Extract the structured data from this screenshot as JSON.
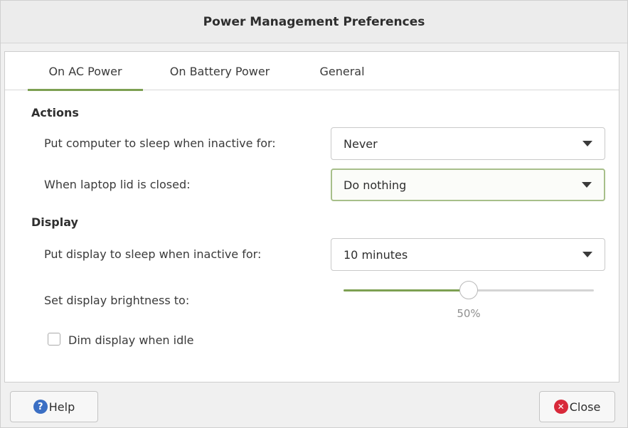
{
  "window": {
    "title": "Power Management Preferences"
  },
  "tabs": [
    {
      "label": "On AC Power",
      "active": true
    },
    {
      "label": "On Battery Power",
      "active": false
    },
    {
      "label": "General",
      "active": false
    }
  ],
  "actions": {
    "heading": "Actions",
    "sleep_label": "Put computer to sleep when inactive for:",
    "sleep_value": "Never",
    "lid_label": "When laptop lid is closed:",
    "lid_value": "Do nothing"
  },
  "display": {
    "heading": "Display",
    "display_sleep_label": "Put display to sleep when inactive for:",
    "display_sleep_value": "10 minutes",
    "brightness_label": "Set display brightness to:",
    "brightness_value_text": "50%",
    "brightness_percent": 50,
    "dim_label": "Dim display when idle",
    "dim_checked": false
  },
  "buttons": {
    "help_label": "Help",
    "close_label": "Close"
  },
  "icons": {
    "help": "help-icon",
    "close": "close-icon",
    "dropdown": "chevron-down-icon"
  },
  "colors": {
    "accent": "#7da052",
    "help_icon": "#3b6fc4",
    "close_icon": "#d8293a"
  }
}
